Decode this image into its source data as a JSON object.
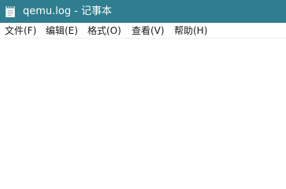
{
  "window": {
    "title": "qemu.log - 记事本",
    "titlebar_color": "#2f7e8f"
  },
  "app_icon": "notepad-icon",
  "menu": {
    "items": [
      {
        "label": "文件(F)"
      },
      {
        "label": "编辑(E)"
      },
      {
        "label": "格式(O)"
      },
      {
        "label": "查看(V)"
      },
      {
        "label": "帮助(H)"
      }
    ]
  },
  "editor": {
    "content": ""
  }
}
